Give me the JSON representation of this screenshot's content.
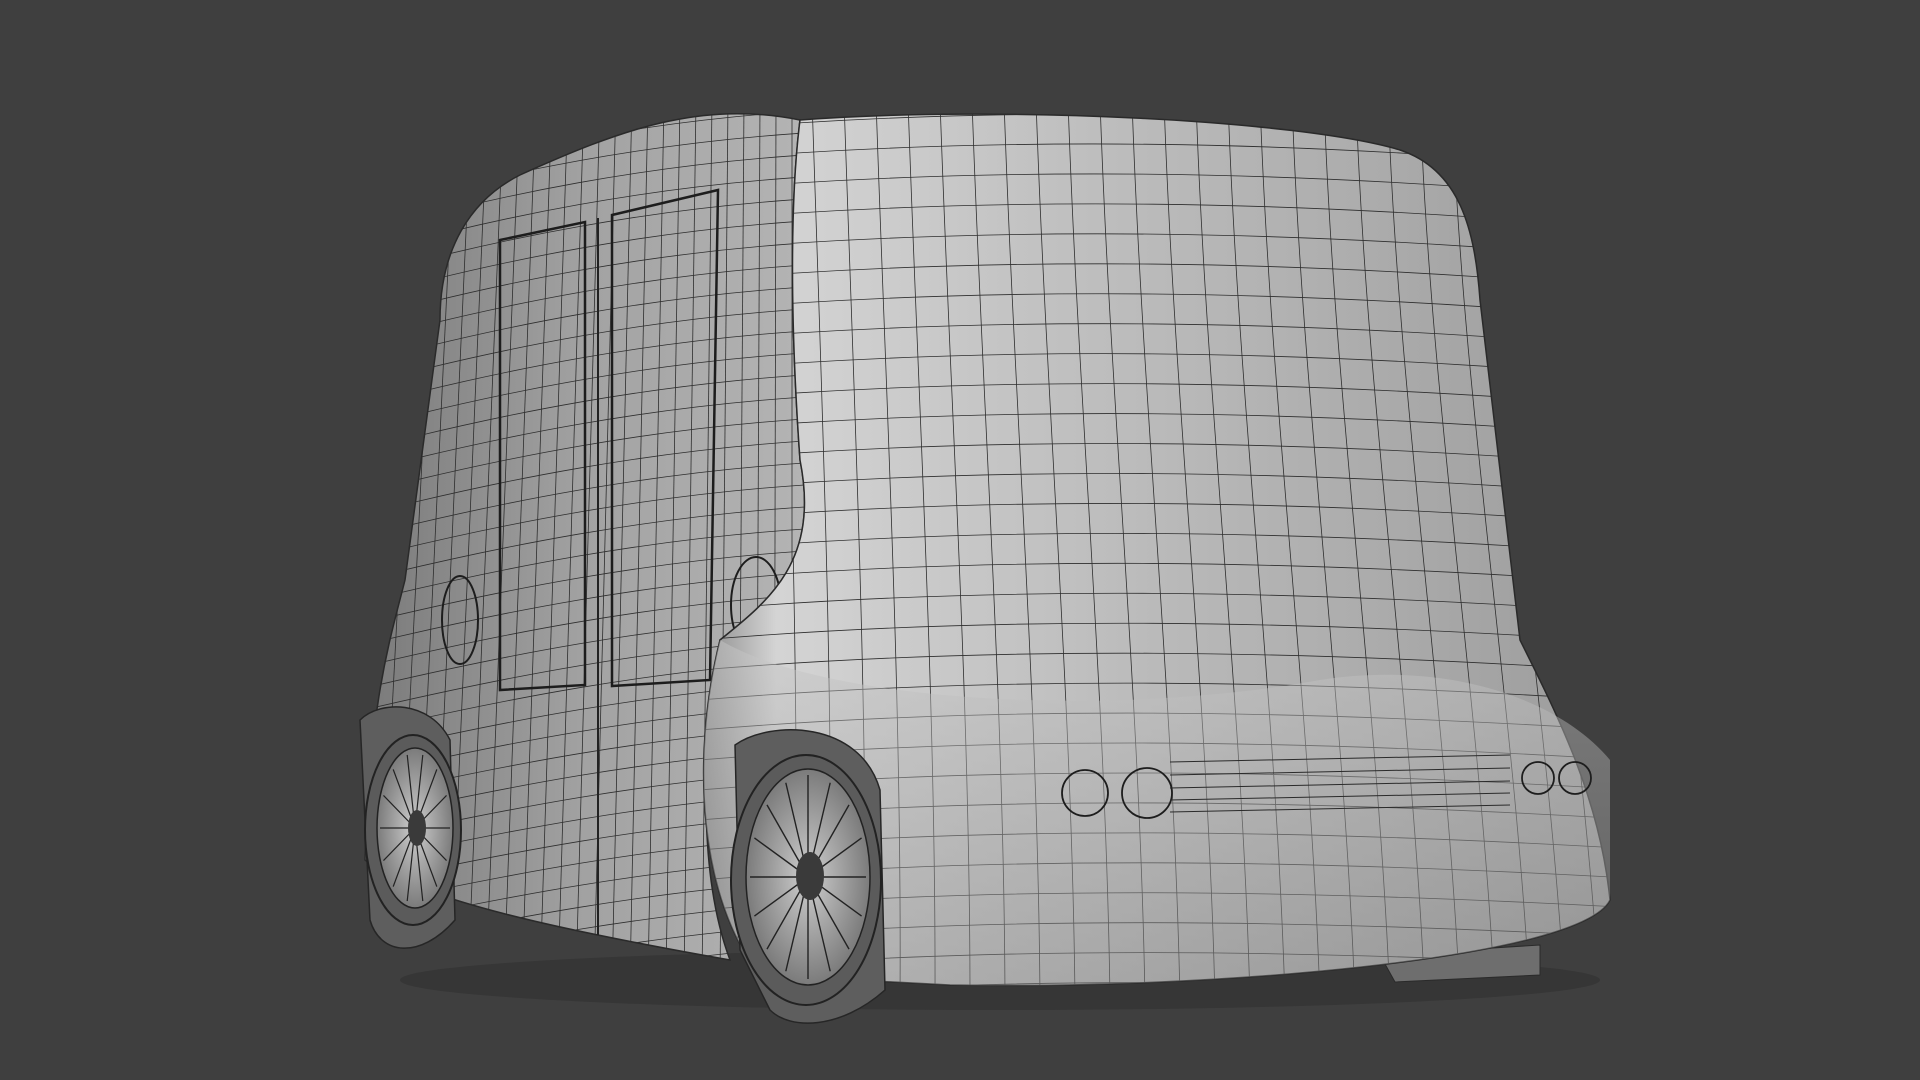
{
  "viewport": {
    "background_color": "#3f3f3f",
    "subject": "wireframe-shuttle-vehicle",
    "mesh_base_color": "#b9b9b9",
    "mesh_shadow_color": "#6c6c6c",
    "wire_color": "#2a2a2a",
    "wheel_rim_color": "#9a9a9a",
    "tire_color": "#5a5a5a"
  }
}
